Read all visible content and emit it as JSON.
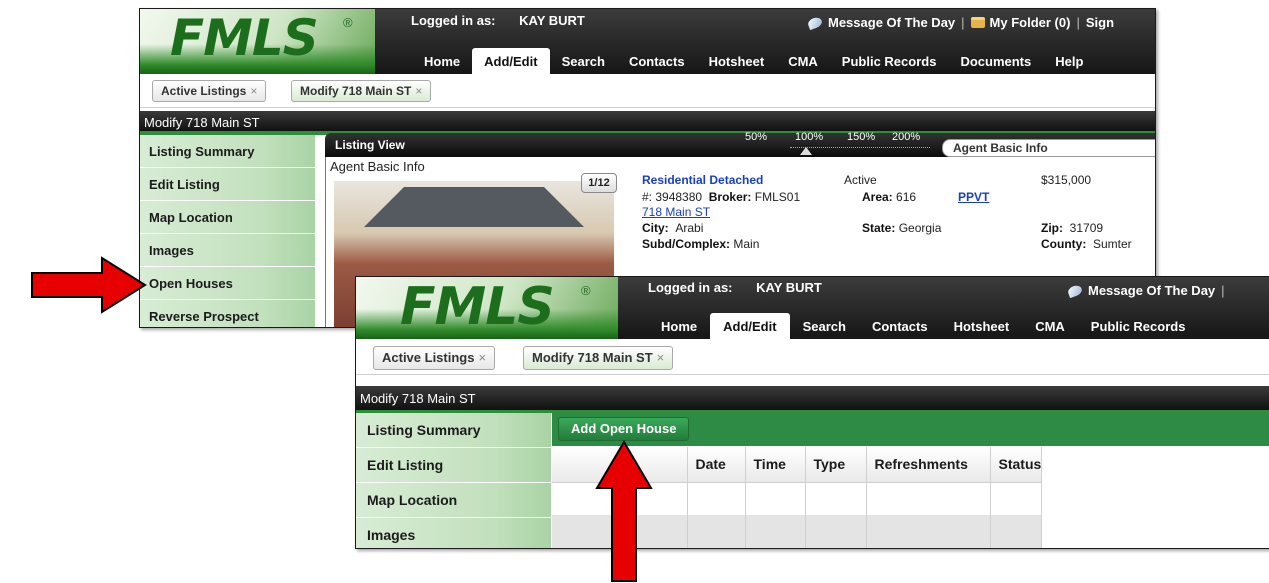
{
  "colors": {
    "accent_green": "#2e8b45",
    "arrow_red": "#e60000"
  },
  "app": {
    "logo_text": "FMLS",
    "logo_mark": "®",
    "logged_in_label": "Logged in as:",
    "user_name": "KAY BURT",
    "motd": "Message Of The Day",
    "my_folder": "My Folder (0)",
    "sign": "Sign",
    "nav_tabs_1": [
      "Home",
      "Add/Edit",
      "Search",
      "Contacts",
      "Hotsheet",
      "CMA",
      "Public Records",
      "Documents",
      "Help"
    ],
    "nav_tabs_2": [
      "Home",
      "Add/Edit",
      "Search",
      "Contacts",
      "Hotsheet",
      "CMA",
      "Public Records"
    ],
    "sub_tabs": [
      "Active Listings",
      "Modify 718 Main ST"
    ],
    "close_glyph": "×",
    "page_title": "Modify 718 Main ST"
  },
  "screen1": {
    "sidebar": [
      "Listing Summary",
      "Edit Listing",
      "Map Location",
      "Images",
      "Open Houses",
      "Reverse Prospect"
    ],
    "listing_view_title": "Listing View",
    "zoom_levels": [
      "50%",
      "100%",
      "150%",
      "200%"
    ],
    "view_select": "Agent Basic Info",
    "section_label": "Agent Basic Info",
    "photo_pager": "1/12",
    "listing": {
      "type": "Residential Detached",
      "status": "Active",
      "price": "$315,000",
      "number_label": "#:",
      "number": "3948380",
      "broker_label": "Broker:",
      "broker": "FMLS01",
      "area_label": "Area:",
      "area": "616",
      "area_link": "PPVT",
      "address": "718 Main ST",
      "city_label": "City:",
      "city": "Arabi",
      "state_label": "State:",
      "state": "Georgia",
      "zip_label": "Zip:",
      "zip": "31709",
      "subd_label": "Subd/Complex:",
      "subd": "Main",
      "county_label": "County:",
      "county": "Sumter"
    }
  },
  "screen2": {
    "sidebar": [
      "Listing Summary",
      "Edit Listing",
      "Map Location",
      "Images"
    ],
    "add_button": "Add Open House",
    "columns": [
      "",
      "Date",
      "Time",
      "Type",
      "Refreshments",
      "Status"
    ]
  }
}
